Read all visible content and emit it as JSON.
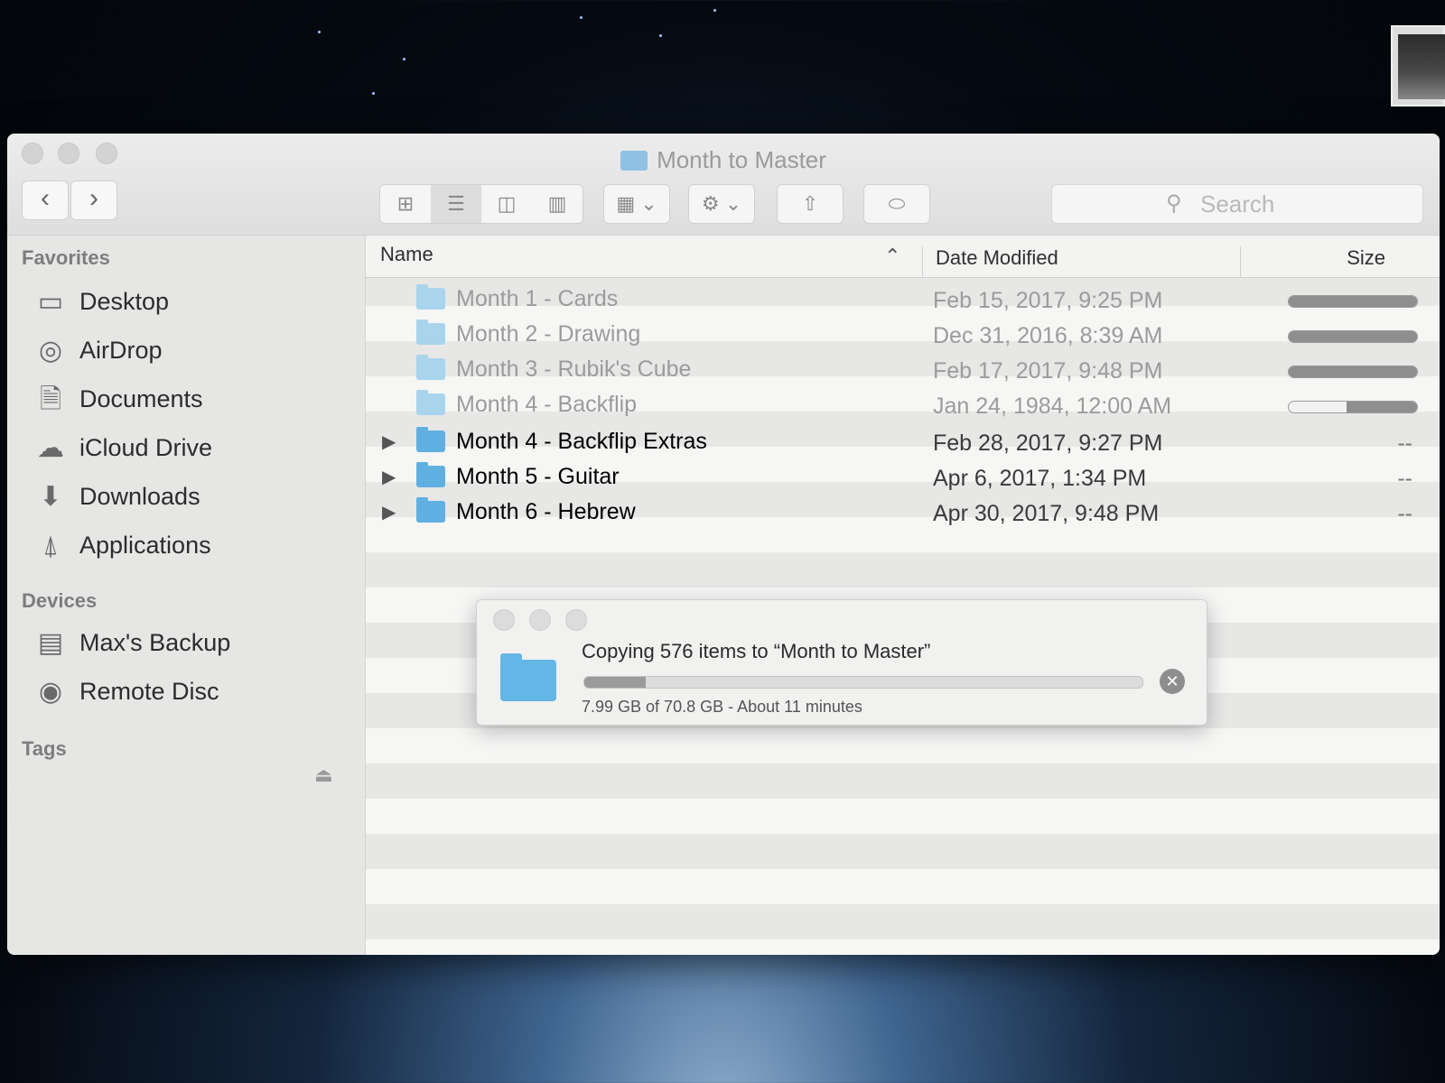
{
  "window": {
    "title": "Month to Master"
  },
  "toolbar": {
    "back_icon": "chevron-left-icon",
    "forward_icon": "chevron-right-icon",
    "search_placeholder": "Search"
  },
  "sidebar": {
    "favorites_header": "Favorites",
    "favorites": [
      {
        "label": "Desktop",
        "icon": "desktop-icon"
      },
      {
        "label": "AirDrop",
        "icon": "airdrop-icon"
      },
      {
        "label": "Documents",
        "icon": "documents-icon"
      },
      {
        "label": "iCloud Drive",
        "icon": "cloud-icon"
      },
      {
        "label": "Downloads",
        "icon": "download-icon"
      },
      {
        "label": "Applications",
        "icon": "applications-icon"
      }
    ],
    "devices_header": "Devices",
    "devices": [
      {
        "label": "Max's Backup",
        "icon": "disk-icon",
        "eject": true
      },
      {
        "label": "Remote Disc",
        "icon": "optical-disc-icon"
      }
    ],
    "tags_header": "Tags"
  },
  "list": {
    "columns": {
      "name": "Name",
      "date": "Date Modified",
      "size": "Size"
    },
    "rows": [
      {
        "name": "Month 1 - Cards",
        "date": "Feb 15, 2017, 9:25 PM",
        "copy_progress": 1.0,
        "dim": true
      },
      {
        "name": "Month 2 - Drawing",
        "date": "Dec 31, 2016, 8:39 AM",
        "copy_progress": 1.0,
        "dim": true
      },
      {
        "name": "Month 3 - Rubik's Cube",
        "date": "Feb 17, 2017, 9:48 PM",
        "copy_progress": 1.0,
        "dim": true
      },
      {
        "name": "Month 4 - Backflip",
        "date": "Jan 24, 1984, 12:00 AM",
        "copy_progress": 0.55,
        "dim": true
      },
      {
        "name": "Month 4 - Backflip Extras",
        "date": "Feb 28, 2017, 9:27 PM",
        "size": "--",
        "dim": false
      },
      {
        "name": "Month 5 - Guitar",
        "date": "Apr 6, 2017, 1:34 PM",
        "size": "--",
        "dim": false
      },
      {
        "name": "Month 6 - Hebrew",
        "date": "Apr 30, 2017, 9:48 PM",
        "size": "--",
        "dim": false
      }
    ]
  },
  "copy_dialog": {
    "title": "Copying 576 items to “Month to Master”",
    "status": "7.99 GB of 70.8 GB - About 11 minutes",
    "progress": 0.11
  }
}
